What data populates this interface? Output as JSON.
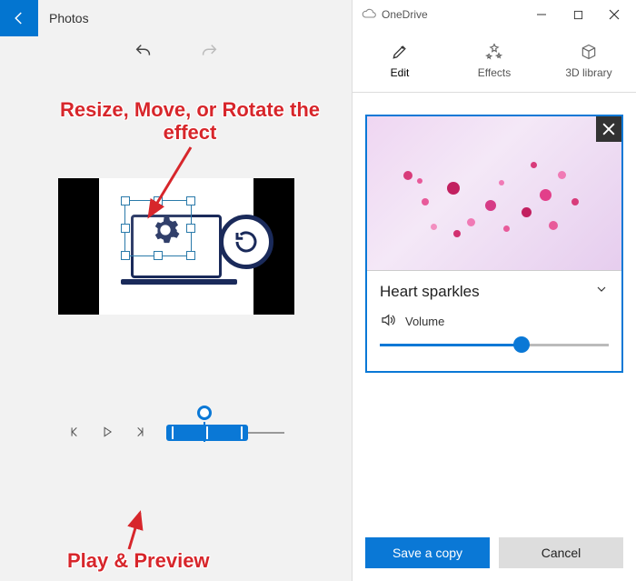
{
  "left": {
    "app_title": "Photos"
  },
  "right": {
    "titlebar": {
      "name": "OneDrive"
    },
    "tabs": {
      "edit": "Edit",
      "effects": "Effects",
      "library": "3D library"
    },
    "effect": {
      "name": "Heart sparkles",
      "volume_label": "Volume",
      "volume_pct": 62
    },
    "buttons": {
      "save": "Save a copy",
      "cancel": "Cancel"
    }
  },
  "annotations": {
    "a1_line1": "Resize, Move, or Rotate the",
    "a1_line2": "effect",
    "a2": "Play & Preview"
  }
}
